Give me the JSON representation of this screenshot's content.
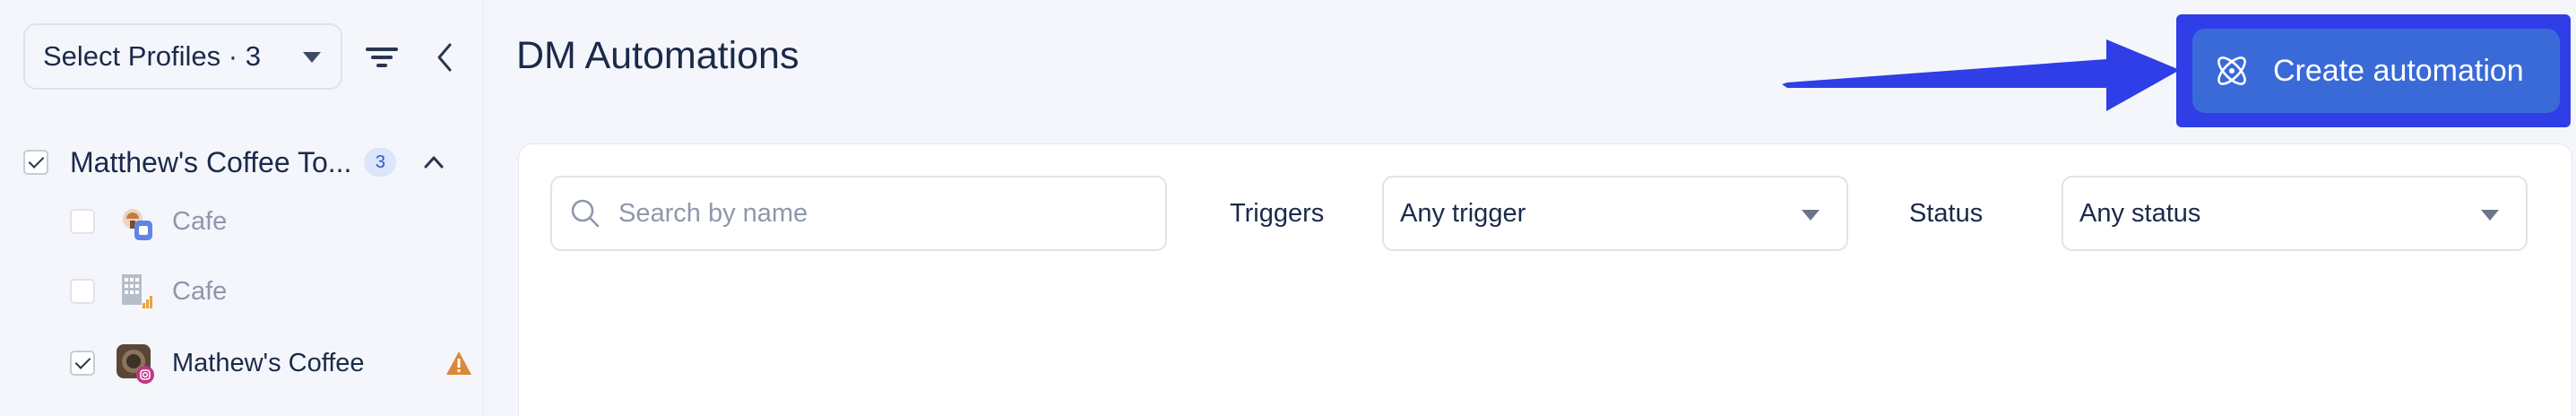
{
  "sidebar": {
    "profile_select_label": "Select Profiles · 3",
    "group": {
      "label": "Matthew's Coffee To...",
      "count": "3"
    },
    "profiles": [
      {
        "label": "Cafe",
        "checked": false,
        "icon": "google-business-icon"
      },
      {
        "label": "Cafe",
        "checked": false,
        "icon": "building-icon"
      },
      {
        "label": "Mathew's Coffee",
        "checked": true,
        "icon": "instagram-icon",
        "warning": true
      }
    ]
  },
  "main": {
    "title": "DM Automations",
    "create_button_label": "Create automation",
    "search": {
      "placeholder": "Search by name"
    },
    "triggers_label": "Triggers",
    "triggers_value": "Any trigger",
    "status_label": "Status",
    "status_value": "Any status"
  },
  "colors": {
    "accent": "#3a6ad8",
    "highlight_frame": "#2f3ee6",
    "arrow": "#2f3ee6",
    "badge_bg": "#dbe5fb",
    "warning": "#d9893a"
  }
}
